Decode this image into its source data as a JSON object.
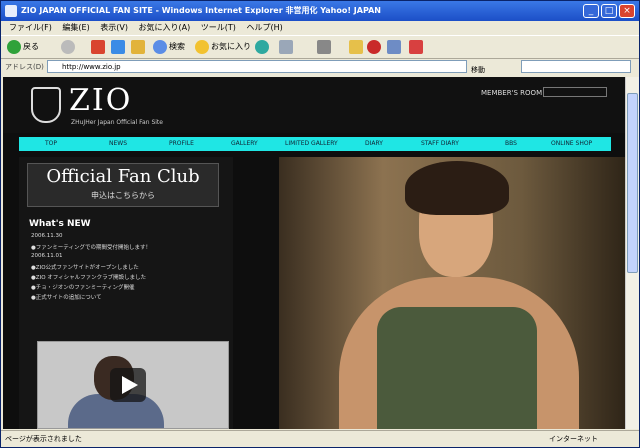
{
  "window": {
    "title": "ZIO JAPAN OFFICIAL FAN SITE - Windows Internet Explorer 非営用化 Yahoo! JAPAN",
    "buttons": {
      "minimize": "_",
      "maximize": "□",
      "close": "×"
    }
  },
  "menubar": {
    "items": [
      "ファイル(F)",
      "編集(E)",
      "表示(V)",
      "お気に入り(A)",
      "ツール(T)",
      "ヘルプ(H)"
    ]
  },
  "toolbar": {
    "back_label": "戻る",
    "search_label": "検索",
    "favorites_label": "お気に入り"
  },
  "address": {
    "label": "アドレス(D)",
    "url": "http://www.zio.jp",
    "go_label": "移動"
  },
  "site": {
    "logo": "ZIO",
    "logo_sub": "ZHuJHer Japan Official Fan Site",
    "member_room": "MEMBER'S ROOM",
    "nav": [
      "TOP",
      "NEWS",
      "PROFILE",
      "GALLERY",
      "LIMITED GALLERY",
      "DIARY",
      "STAFF DIARY",
      "BBS",
      "ONLINE SHOP"
    ],
    "banner_title": "Official Fan Club",
    "banner_sub": "申込はこちらから",
    "whats_new": "What's NEW",
    "news": [
      "2006.11.30",
      "●ファンミーティングでの期間受付開始します！",
      "2006.11.01",
      "●ZIO公式ファンサイトがオープンしました",
      "●ZIO オフィシャルファンクラブ開設しました",
      "●チョ・ジオンのファンミーティング開催",
      "●正式サイトの追加について"
    ]
  },
  "statusbar": {
    "left": "ページが表示されました",
    "right": "インターネット"
  }
}
